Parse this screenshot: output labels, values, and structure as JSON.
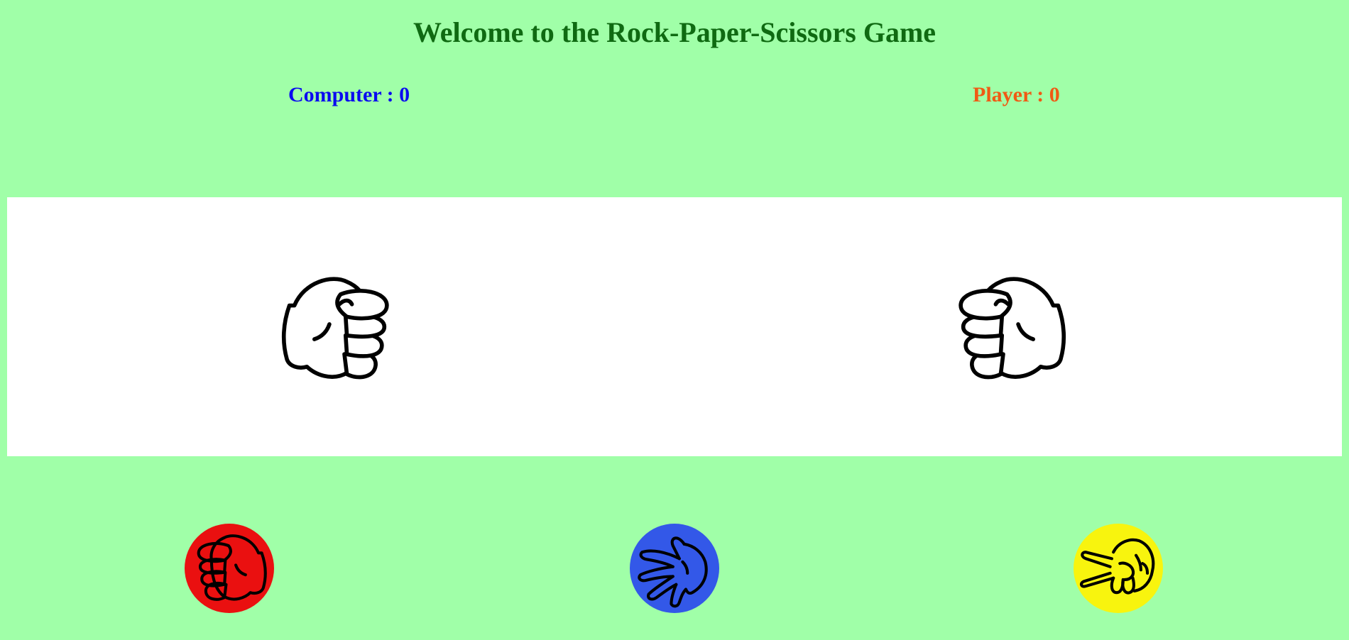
{
  "title": "Welcome to the Rock-Paper-Scissors Game",
  "scores": {
    "computer_label": "Computer : 0",
    "player_label": "Player : 0",
    "computer_value": 0,
    "player_value": 0
  },
  "arena": {
    "computer_hand": "rock-hand-icon",
    "player_hand": "rock-hand-icon"
  },
  "choices": [
    {
      "name": "rock",
      "icon": "rock-hand-icon",
      "color": "#ea1010"
    },
    {
      "name": "paper",
      "icon": "paper-hand-icon",
      "color": "#3358e8"
    },
    {
      "name": "scissors",
      "icon": "scissors-hand-icon",
      "color": "#f8f40e"
    }
  ],
  "colors": {
    "background": "#a0ffa8",
    "title": "#0f6a12",
    "computer_score": "#0a0af0",
    "player_score": "#f05a14",
    "arena": "#ffffff"
  }
}
